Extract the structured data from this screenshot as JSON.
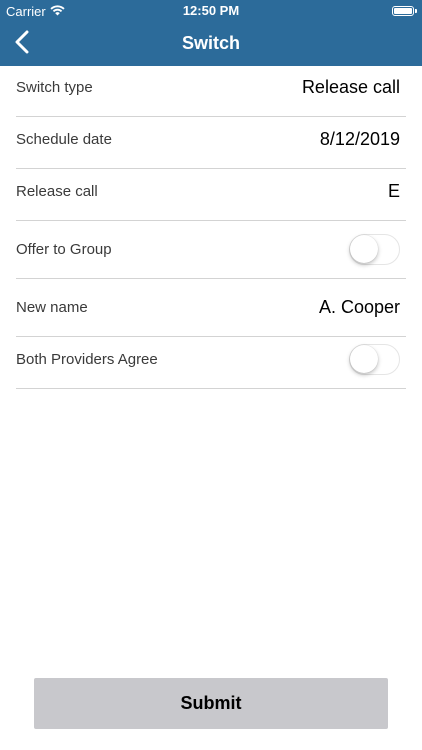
{
  "status_bar": {
    "carrier": "Carrier",
    "time": "12:50 PM",
    "icons": [
      "wifi-icon",
      "battery-icon"
    ]
  },
  "nav": {
    "title": "Switch",
    "back_icon": "chevron-left-icon"
  },
  "form": {
    "switch_type": {
      "label": "Switch type",
      "value": "Release call"
    },
    "schedule_date": {
      "label": "Schedule date",
      "value": "8/12/2019"
    },
    "release_call": {
      "label": "Release call",
      "value": "E"
    },
    "offer_to_group": {
      "label": "Offer to Group",
      "on": false
    },
    "new_name": {
      "label": "New name",
      "value": "A. Cooper"
    },
    "both_providers_agree": {
      "label": "Both Providers Agree",
      "on": false
    }
  },
  "submit": {
    "label": "Submit"
  },
  "colors": {
    "header": "#2c6b9a",
    "divider": "#d3d3d3",
    "submit_bg": "#c8c8cc"
  }
}
